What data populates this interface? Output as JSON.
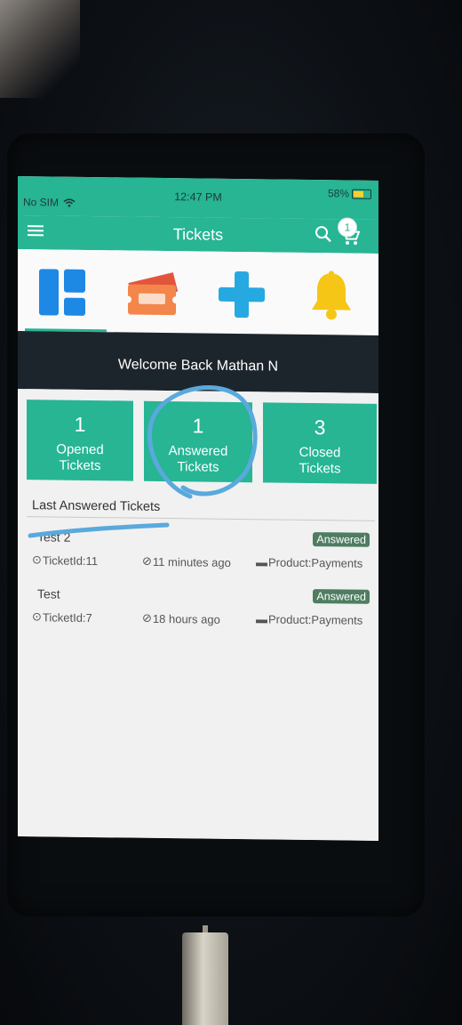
{
  "status_bar": {
    "carrier": "No SIM",
    "time": "12:47 PM",
    "battery": "58%"
  },
  "app_bar": {
    "title": "Tickets",
    "cart_count": "1"
  },
  "icon_tabs": [
    {
      "icon": "dashboard-icon"
    },
    {
      "icon": "ticket-icon"
    },
    {
      "icon": "add-plus-icon"
    },
    {
      "icon": "bell-icon"
    }
  ],
  "welcome": "Welcome Back Mathan N",
  "stats": [
    {
      "count": "1",
      "label": "Opened Tickets"
    },
    {
      "count": "1",
      "label": "Answered Tickets"
    },
    {
      "count": "3",
      "label": "Closed Tickets"
    }
  ],
  "section_title": "Last Answered Tickets",
  "tickets": [
    {
      "title": "Test 2",
      "status": "Answered",
      "ticket_id": "TicketId:11",
      "time": "11 minutes ago",
      "product": "Product:Payments"
    },
    {
      "title": "Test",
      "status": "Answered",
      "ticket_id": "TicketId:7",
      "time": "18 hours ago",
      "product": "Product:Payments"
    }
  ],
  "colors": {
    "primary": "#27b594",
    "badge": "#4f7d62",
    "annotation": "#5aa9dd",
    "bell": "#f6c616",
    "tab_blue": "#1e88e5",
    "plus": "#26a9e0"
  }
}
